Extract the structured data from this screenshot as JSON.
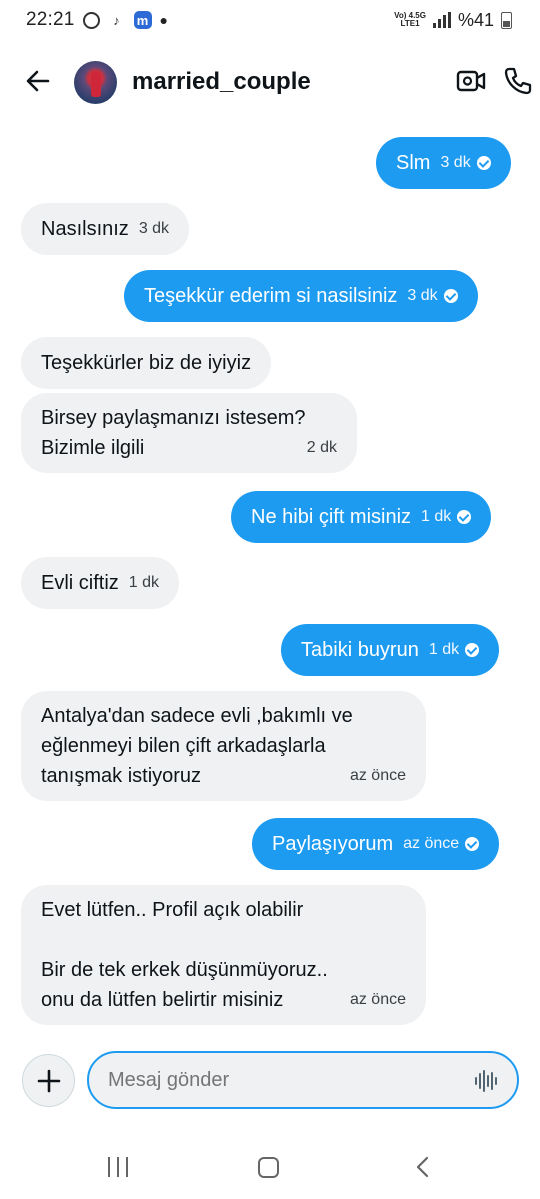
{
  "status_bar": {
    "time": "22:21",
    "network_top": "Vo) 4.5G",
    "network_bottom": "LTE1",
    "battery": "%41"
  },
  "header": {
    "contact_name": "married_couple"
  },
  "messages": [
    {
      "side": "sent",
      "text": "Slm",
      "time": "3 dk"
    },
    {
      "side": "received",
      "text": "Nasılsınız",
      "time": "3 dk"
    },
    {
      "side": "sent",
      "text": "Teşekkür ederim si nasilsiniz",
      "time": "3 dk"
    },
    {
      "side": "received",
      "text": "Teşekkürler biz de iyiyiz"
    },
    {
      "side": "received",
      "lines": [
        "Birsey paylaşmanızı istesem?",
        "Bizimle ilgili"
      ],
      "time": "2 dk"
    },
    {
      "side": "sent",
      "text": "Ne hibi çift misiniz",
      "time": "1 dk"
    },
    {
      "side": "received",
      "text": "Evli ciftiz",
      "time": "1 dk"
    },
    {
      "side": "sent",
      "text": "Tabiki buyrun",
      "time": "1 dk"
    },
    {
      "side": "received",
      "lines": [
        "Antalya'dan sadece evli ,bakımlı ve",
        "eğlenmeyi bilen çift arkadaşlarla",
        "tanışmak istiyoruz"
      ],
      "time": "az önce"
    },
    {
      "side": "sent",
      "text": "Paylaşıyorum",
      "time": "az önce"
    },
    {
      "side": "received",
      "lines": [
        "Evet lütfen.. Profil açık olabilir",
        "",
        "Bir de tek erkek düşünmüyoruz..",
        "onu da lütfen belirtir misiniz"
      ],
      "time": "az önce"
    }
  ],
  "composer": {
    "placeholder": "Mesaj gönder"
  },
  "icons": {
    "back": "arrow-left-icon",
    "video": "video-camera-icon",
    "phone": "phone-icon",
    "add": "plus-icon",
    "voice": "voice-waveform-icon"
  },
  "colors": {
    "sent_bubble": "#1d9bf0",
    "received_bubble": "#eff1f3",
    "accent": "#1d9bf0"
  }
}
